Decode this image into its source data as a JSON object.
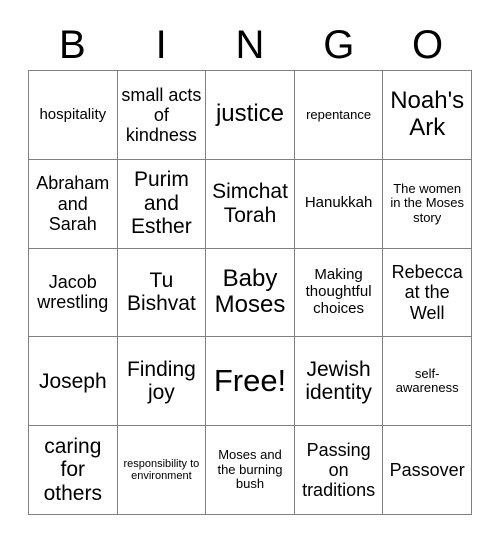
{
  "card": {
    "title_letters": [
      "B",
      "I",
      "N",
      "G",
      "O"
    ],
    "border_color": "#808080",
    "text_color": "#000000",
    "background_color": "#ffffff",
    "columns": 5,
    "rows": 5,
    "free_space_label": "Free!",
    "free_space_position": "row3-col3"
  },
  "cells": [
    {
      "text": "hospitality",
      "size": "sm"
    },
    {
      "text": "small acts of kindness",
      "size": "md"
    },
    {
      "text": "justice",
      "size": "xl"
    },
    {
      "text": "repentance",
      "size": "xs"
    },
    {
      "text": "Noah's Ark",
      "size": "xl"
    },
    {
      "text": "Abraham and Sarah",
      "size": "md"
    },
    {
      "text": "Purim and Esther",
      "size": "lg"
    },
    {
      "text": "Simchat Torah",
      "size": "lg"
    },
    {
      "text": "Hanukkah",
      "size": "sm"
    },
    {
      "text": "The women in the Moses story",
      "size": "xs"
    },
    {
      "text": "Jacob wrestling",
      "size": "md"
    },
    {
      "text": "Tu Bishvat",
      "size": "lg"
    },
    {
      "text": "Baby Moses",
      "size": "xl"
    },
    {
      "text": "Making thoughtful choices",
      "size": "sm"
    },
    {
      "text": "Rebecca at the Well",
      "size": "md"
    },
    {
      "text": "Joseph",
      "size": "lg"
    },
    {
      "text": "Finding joy",
      "size": "lg"
    },
    {
      "text": "Free!",
      "size": "xxl"
    },
    {
      "text": "Jewish identity",
      "size": "lg"
    },
    {
      "text": "self-awareness",
      "size": "xs"
    },
    {
      "text": "caring for others",
      "size": "lg"
    },
    {
      "text": "responsibility to environment",
      "size": "xxs"
    },
    {
      "text": "Moses and the burning bush",
      "size": "xs"
    },
    {
      "text": "Passing on traditions",
      "size": "md"
    },
    {
      "text": "Passover",
      "size": "md"
    }
  ]
}
